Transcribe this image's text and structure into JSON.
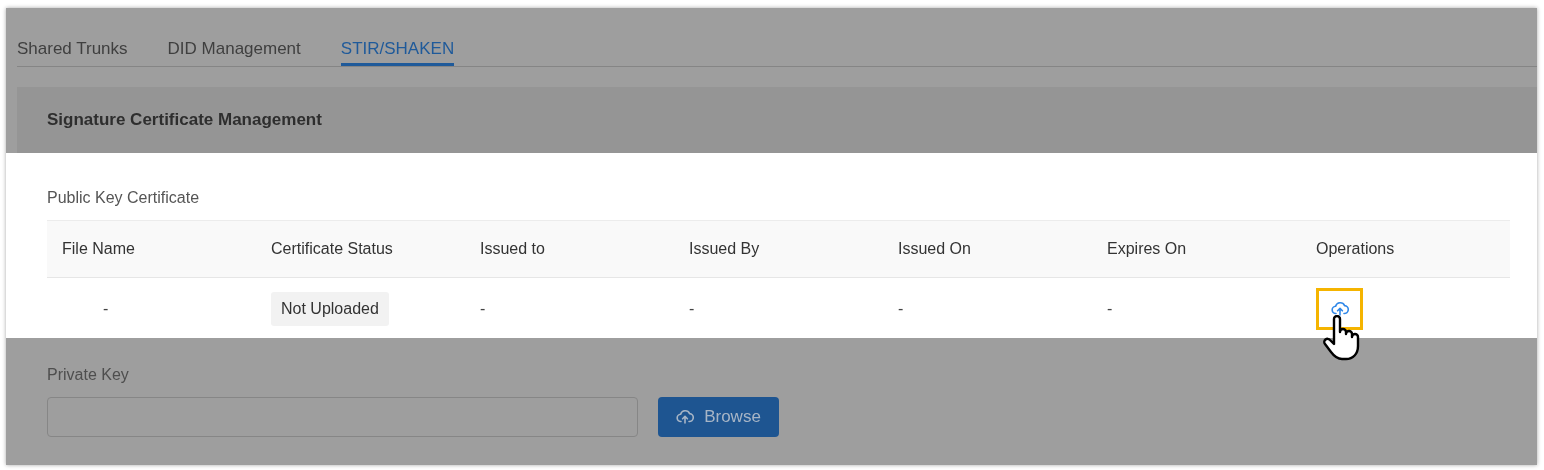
{
  "tabs": [
    {
      "label": "Shared Trunks",
      "selected": false
    },
    {
      "label": "DID Management",
      "selected": false
    },
    {
      "label": "STIR/SHAKEN",
      "selected": true
    }
  ],
  "panel": {
    "title": "Signature Certificate Management",
    "dimmed": true
  },
  "public_key": {
    "label": "Public Key Certificate",
    "dimmed": false,
    "table": {
      "columns": [
        "File Name",
        "Certificate Status",
        "Issued to",
        "Issued By",
        "Issued On",
        "Expires On",
        "Operations"
      ],
      "rows": [
        {
          "cells": [
            {
              "kind": "text",
              "text": "-"
            },
            {
              "kind": "status",
              "text": "Not Uploaded"
            },
            {
              "kind": "text",
              "text": "-"
            },
            {
              "kind": "text",
              "text": "-"
            },
            {
              "kind": "text",
              "text": "-"
            },
            {
              "kind": "text",
              "text": "-"
            },
            {
              "kind": "upload",
              "highlighted": true
            }
          ]
        }
      ]
    }
  },
  "private_key": {
    "label": "Private Key",
    "dimmed": true,
    "button": "Browse"
  }
}
